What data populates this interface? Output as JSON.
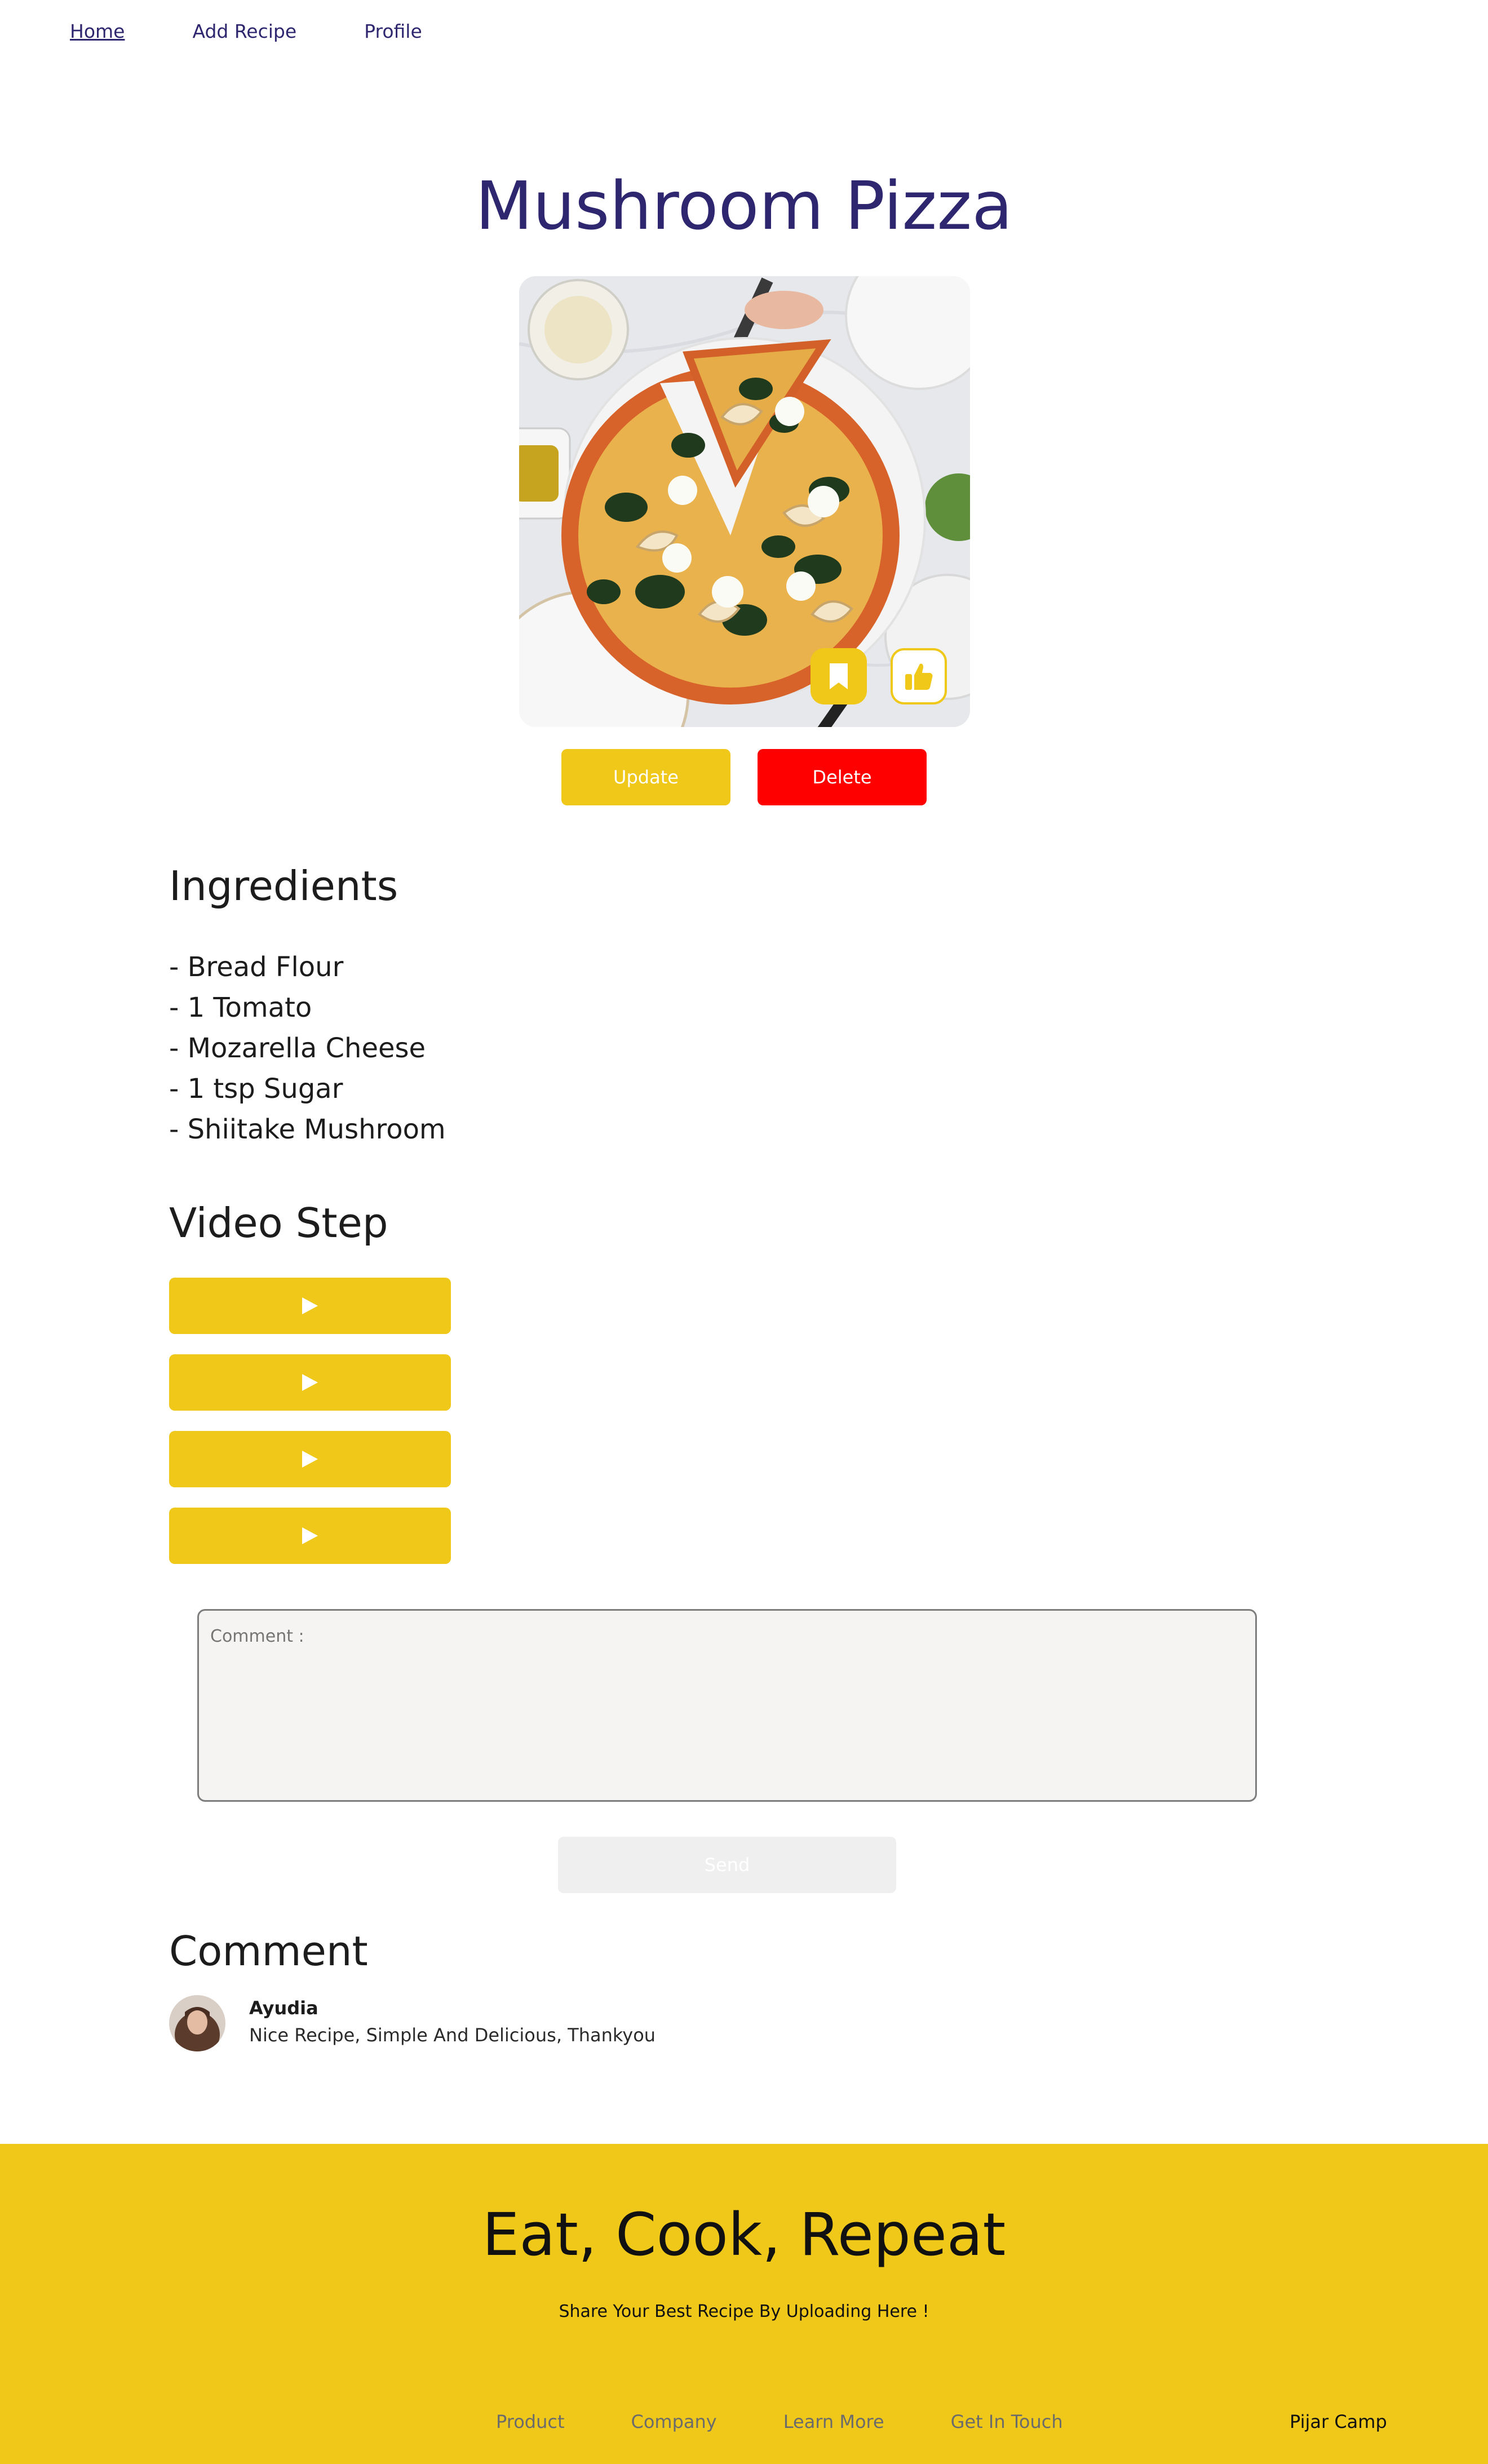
{
  "nav": {
    "items": [
      {
        "label": "Home",
        "active": true
      },
      {
        "label": "Add Recipe",
        "active": false
      },
      {
        "label": "Profile",
        "active": false
      }
    ]
  },
  "recipe": {
    "title": "Mushroom Pizza",
    "image_icon": "pizza-photo",
    "actions": {
      "update_label": "Update",
      "delete_label": "Delete"
    }
  },
  "ingredients": {
    "title": "Ingredients",
    "items": [
      "- Bread Flour",
      "- 1 Tomato",
      "- Mozarella Cheese",
      "- 1 tsp Sugar",
      "- Shiitake Mushroom"
    ]
  },
  "video_steps": {
    "title": "Video Step",
    "count": 4,
    "icon": "play-icon"
  },
  "comment_form": {
    "placeholder": "Comment :",
    "send_label": "Send"
  },
  "comments": {
    "title": "Comment",
    "items": [
      {
        "name": "Ayudia",
        "text": "Nice Recipe, Simple And Delicious, Thankyou"
      }
    ]
  },
  "footer": {
    "title": "Eat, Cook, Repeat",
    "subtitle": "Share Your Best Recipe By Uploading Here !",
    "links": [
      "Product",
      "Company",
      "Learn More",
      "Get In Touch"
    ],
    "brand": "Pijar Camp"
  },
  "colors": {
    "accent": "#efc81a",
    "danger": "#ff0000",
    "title": "#2e266f"
  }
}
